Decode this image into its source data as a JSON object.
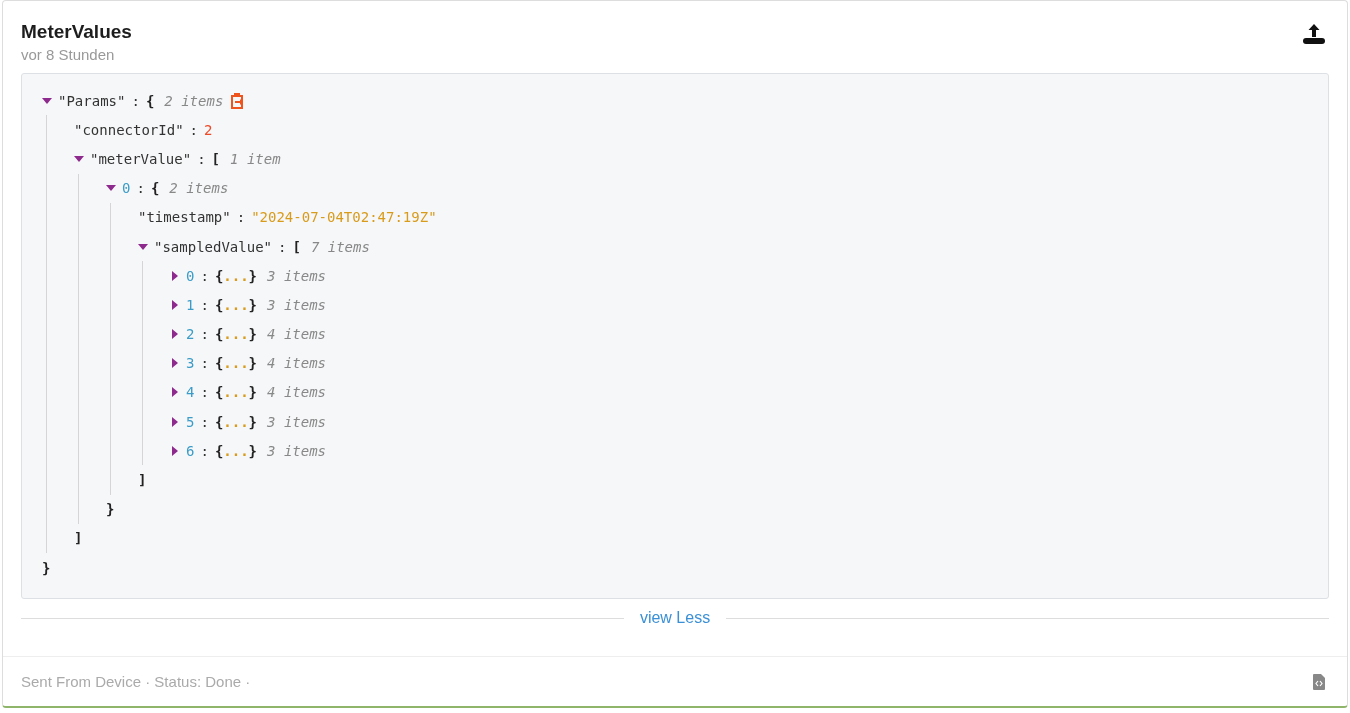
{
  "header": {
    "title": "MeterValues",
    "time": "vor 8 Stunden"
  },
  "separator": ":",
  "tree": {
    "key": "\"Params\"",
    "kind": "field",
    "bracket": "{",
    "count": "2 items",
    "expanded": true,
    "copyable": true,
    "close": "}",
    "children": [
      {
        "key": "\"connectorId\"",
        "kind": "number",
        "value": "2"
      },
      {
        "key": "\"meterValue\"",
        "kind": "field",
        "bracket": "[",
        "count": "1 item",
        "expanded": true,
        "close": "]",
        "children": [
          {
            "key": "0",
            "kind": "element",
            "bracket": "{",
            "count": "2 items",
            "expanded": true,
            "close": "}",
            "children": [
              {
                "key": "\"timestamp\"",
                "kind": "string",
                "value": "\"2024-07-04T02:47:19Z\""
              },
              {
                "key": "\"sampledValue\"",
                "kind": "field",
                "bracket": "[",
                "count": "7 items",
                "expanded": true,
                "close": "]",
                "children": [
                  {
                    "key": "0",
                    "kind": "element",
                    "preview": "{...}",
                    "count": "3 items",
                    "expanded": false
                  },
                  {
                    "key": "1",
                    "kind": "element",
                    "preview": "{...}",
                    "count": "3 items",
                    "expanded": false
                  },
                  {
                    "key": "2",
                    "kind": "element",
                    "preview": "{...}",
                    "count": "4 items",
                    "expanded": false
                  },
                  {
                    "key": "3",
                    "kind": "element",
                    "preview": "{...}",
                    "count": "4 items",
                    "expanded": false
                  },
                  {
                    "key": "4",
                    "kind": "element",
                    "preview": "{...}",
                    "count": "4 items",
                    "expanded": false
                  },
                  {
                    "key": "5",
                    "kind": "element",
                    "preview": "{...}",
                    "count": "3 items",
                    "expanded": false
                  },
                  {
                    "key": "6",
                    "kind": "element",
                    "preview": "{...}",
                    "count": "3 items",
                    "expanded": false
                  }
                ]
              }
            ]
          }
        ]
      }
    ]
  },
  "toggle_link": "view Less",
  "footer": {
    "text": "Sent From Device · Status: Done ·"
  }
}
